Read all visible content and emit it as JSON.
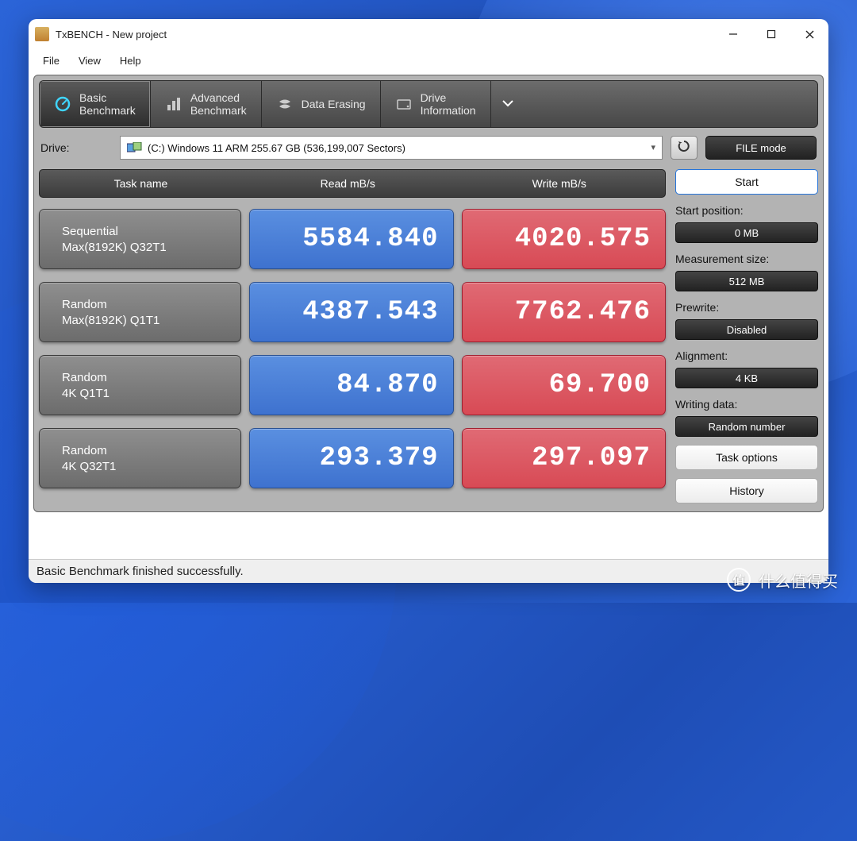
{
  "window": {
    "title": "TxBENCH - New project"
  },
  "menu": {
    "file": "File",
    "view": "View",
    "help": "Help"
  },
  "tabs": {
    "basic_l1": "Basic",
    "basic_l2": "Benchmark",
    "adv_l1": "Advanced",
    "adv_l2": "Benchmark",
    "erase": "Data Erasing",
    "drive_l1": "Drive",
    "drive_l2": "Information"
  },
  "drive": {
    "label": "Drive:",
    "value": "(C:) Windows 11 ARM  255.67 GB (536,199,007 Sectors)",
    "mode": "FILE mode"
  },
  "headers": {
    "task": "Task name",
    "read": "Read mB/s",
    "write": "Write mB/s"
  },
  "rows": [
    {
      "name_l1": "Sequential",
      "name_l2": "Max(8192K) Q32T1",
      "read": "5584.840",
      "write": "4020.575"
    },
    {
      "name_l1": "Random",
      "name_l2": "Max(8192K) Q1T1",
      "read": "4387.543",
      "write": "7762.476"
    },
    {
      "name_l1": "Random",
      "name_l2": "4K Q1T1",
      "read": "84.870",
      "write": "69.700"
    },
    {
      "name_l1": "Random",
      "name_l2": "4K Q32T1",
      "read": "293.379",
      "write": "297.097"
    }
  ],
  "sidebar": {
    "start": "Start",
    "start_pos_label": "Start position:",
    "start_pos": "0 MB",
    "size_label": "Measurement size:",
    "size": "512 MB",
    "prewrite_label": "Prewrite:",
    "prewrite": "Disabled",
    "align_label": "Alignment:",
    "align": "4 KB",
    "writing_label": "Writing data:",
    "writing": "Random number",
    "task_opts": "Task options",
    "history": "History"
  },
  "status": "Basic Benchmark finished successfully.",
  "watermark": "什么值得买"
}
